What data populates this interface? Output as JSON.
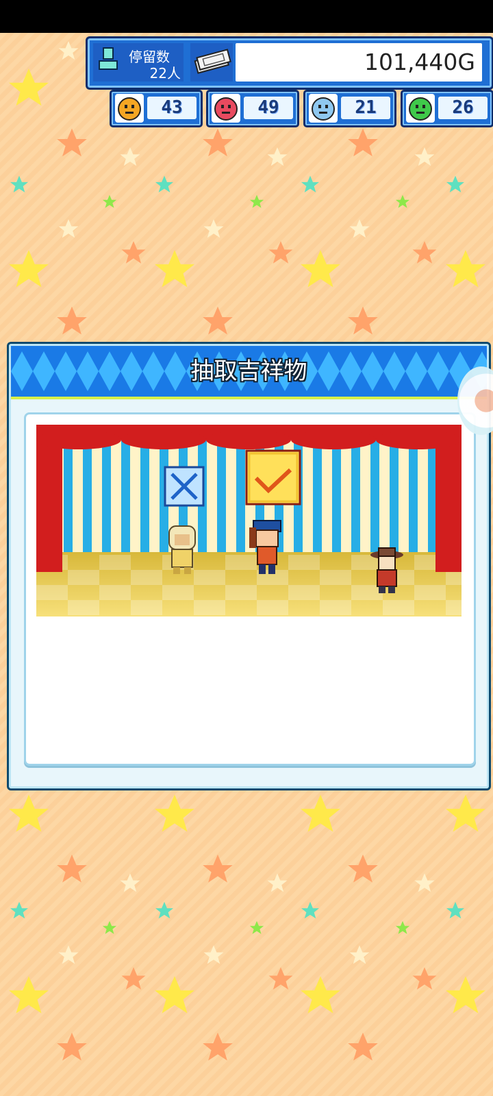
{
  "guests": {
    "label": "停留数",
    "count": "22人"
  },
  "money": {
    "amount": "101,440G"
  },
  "stats": [
    {
      "icon": "smile-face-icon",
      "value": "43",
      "color": "#f5a623"
    },
    {
      "icon": "flame-face-icon",
      "value": "49",
      "color": "#e84a5f"
    },
    {
      "icon": "drop-face-icon",
      "value": "21",
      "color": "#8fc8f0"
    },
    {
      "icon": "star-face-icon",
      "value": "26",
      "color": "#3fc94a"
    }
  ],
  "dialog": {
    "title": "抽取吉祥物",
    "choice_no": "x-mark-icon",
    "choice_yes": "check-mark-icon"
  },
  "colors": {
    "background": "#fdd7a4",
    "panel": "#1f6fd4",
    "header": "#1a7ae6",
    "curtain": "#d21e1e"
  }
}
